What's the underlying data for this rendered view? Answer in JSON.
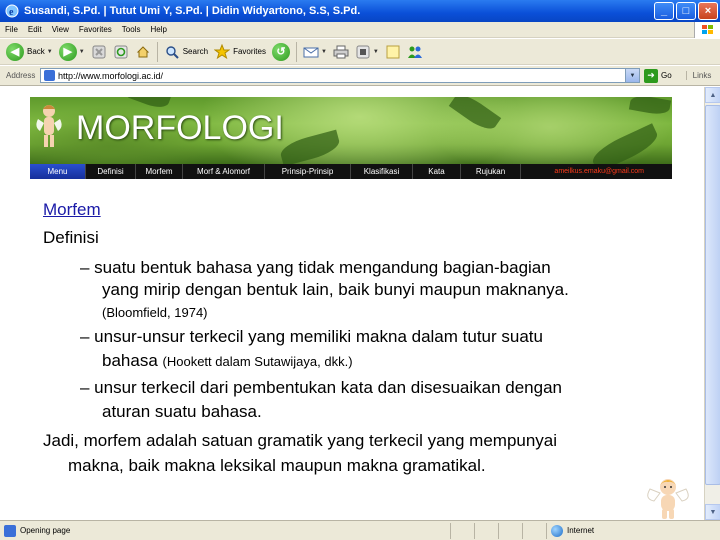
{
  "window": {
    "title": "Susandi, S.Pd. | Tutut Umi Y, S.Pd. | Didin Widyartono, S.S, S.Pd."
  },
  "menu": {
    "items": [
      "File",
      "Edit",
      "View",
      "Favorites",
      "Tools",
      "Help"
    ]
  },
  "toolbar": {
    "back_label": "Back",
    "search_label": "Search",
    "favorites_label": "Favorites"
  },
  "address": {
    "label": "Address",
    "url": "http://www.morfologi.ac.id/",
    "go_label": "Go",
    "links_label": "Links"
  },
  "banner": {
    "title": "MORFOLOGI"
  },
  "nav": {
    "items": [
      "Menu",
      "Definisi",
      "Morfem",
      "Morf & Alomorf",
      "Prinsip-Prinsip",
      "Klasifikasi",
      "Kata",
      "Rujukan"
    ],
    "active": "Menu",
    "email": "ameilkus.emaku@gmail.com"
  },
  "slide": {
    "heading_link": "Morfem",
    "definition_label": "Definisi",
    "bullet1_line1": "– suatu bentuk bahasa yang tidak mengandung bagian-bagian",
    "bullet1_line2": "yang mirip dengan bentuk lain, baik bunyi maupun maknanya.",
    "bullet1_citation": "(Bloomfield, 1974)",
    "bullet2_line1": "– unsur-unsur terkecil yang memiliki makna dalam tutur suatu",
    "bullet2_line2_main": "bahasa",
    "bullet2_line2_citation": "(Hookett dalam Sutawijaya, dkk.)",
    "bullet3_line1": "– unsur terkecil dari pembentukan kata dan disesuaikan dengan",
    "bullet3_line2": "aturan suatu bahasa.",
    "conclusion_line1": "Jadi, morfem adalah satuan gramatik yang terkecil yang mempunyai",
    "conclusion_line2": "makna, baik makna leksikal maupun makna gramatikal."
  },
  "status": {
    "text": "Opening page",
    "zone": "Internet"
  },
  "colors": {
    "titlebar": "#0a4fd8",
    "chrome": "#ece9d8",
    "nav_active": "#2a4fd0",
    "email": "#ff3a1a",
    "link": "#1a1aa8"
  }
}
